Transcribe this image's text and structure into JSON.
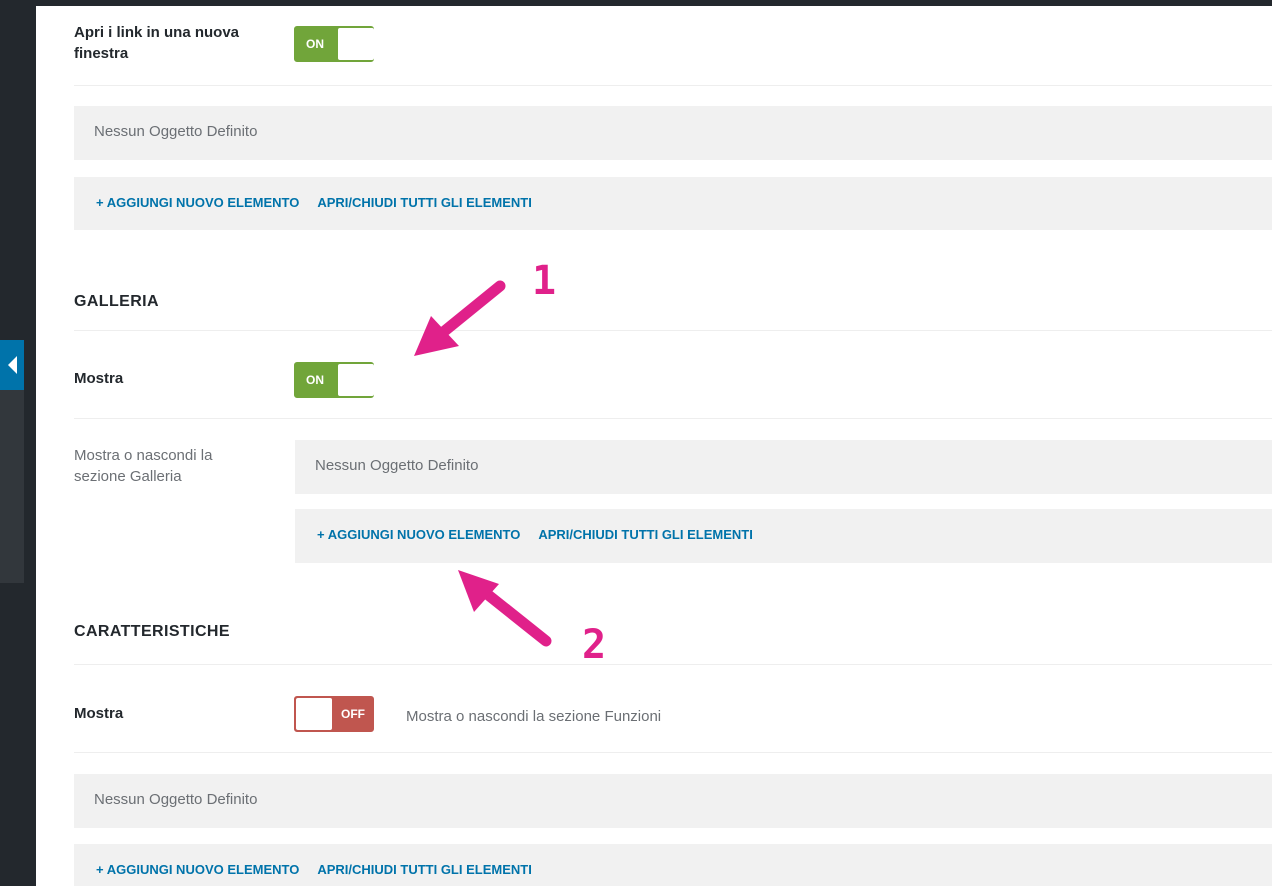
{
  "colors": {
    "accent": "#0073aa",
    "on": "#71a53a",
    "off": "#c0564f",
    "annotation": "#e0218a"
  },
  "links_section": {
    "new_window_label": "Apri i link in una nuova finestra",
    "new_window_state": "ON",
    "empty_text": "Nessun Oggetto Definito",
    "add_label": "+ AGGIUNGI NUOVO ELEMENTO",
    "toggle_all_label": "APRI/CHIUDI TUTTI GLI ELEMENTI"
  },
  "gallery": {
    "heading": "GALLERIA",
    "show_label": "Mostra",
    "show_state": "ON",
    "description": "Mostra o nascondi la sezione Galleria",
    "empty_text": "Nessun Oggetto Definito",
    "add_label": "+ AGGIUNGI NUOVO ELEMENTO",
    "toggle_all_label": "APRI/CHIUDI TUTTI GLI ELEMENTI"
  },
  "features": {
    "heading": "CARATTERISTICHE",
    "show_label": "Mostra",
    "show_state": "OFF",
    "description": "Mostra o nascondi la sezione Funzioni",
    "empty_text": "Nessun Oggetto Definito",
    "add_label": "+ AGGIUNGI NUOVO ELEMENTO",
    "toggle_all_label": "APRI/CHIUDI TUTTI GLI ELEMENTI"
  },
  "annotations": {
    "one": "1",
    "two": "2"
  },
  "icons": {
    "collapse": "chevron-left-icon",
    "arrow": "annotation-arrow-icon"
  }
}
